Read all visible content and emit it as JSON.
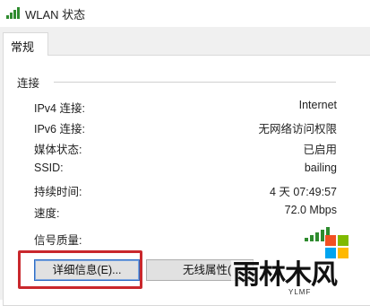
{
  "window": {
    "title": "WLAN 状态"
  },
  "tabs": [
    {
      "label": "常规"
    }
  ],
  "connection": {
    "group_title": "连接",
    "rows": [
      {
        "label": "IPv4 连接:",
        "value": "Internet"
      },
      {
        "label": "IPv6 连接:",
        "value": "无网络访问权限"
      },
      {
        "label": "媒体状态:",
        "value": "已启用"
      },
      {
        "label": "SSID:",
        "value": "bailing"
      },
      {
        "label": "持续时间:",
        "value": "4 天 07:49:57"
      },
      {
        "label": "速度:",
        "value": "72.0 Mbps"
      }
    ],
    "signal_label": "信号质量:",
    "signal_icon": "signal-strength-icon"
  },
  "buttons": {
    "details_label": "详细信息(E)...",
    "wireless_label": "无线属性("
  },
  "watermark": {
    "logo_icon": "windows-logo-icon",
    "text": "雨林木风",
    "small_text": "YLMF"
  },
  "colors": {
    "highlight": "#c9282d",
    "signal_green": "#2e8b2e",
    "logo_red": "#f25022",
    "logo_green": "#7fba00",
    "logo_blue": "#00a4ef",
    "logo_yellow": "#ffb900"
  }
}
